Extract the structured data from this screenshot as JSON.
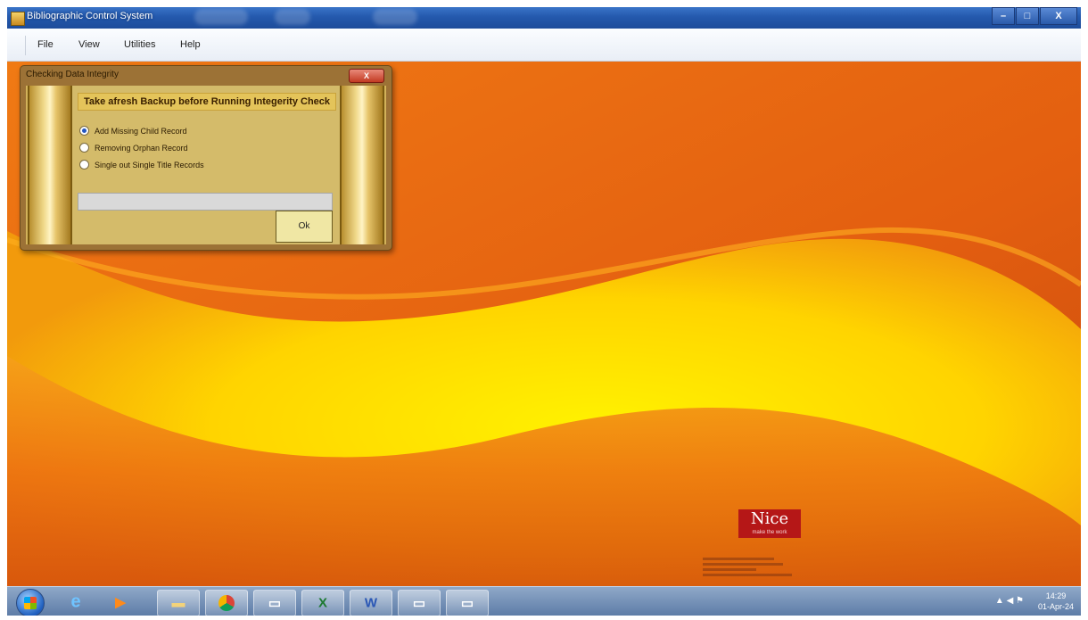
{
  "window": {
    "title": "Bibliographic Control System",
    "minimize_glyph": "–",
    "maximize_glyph": "□",
    "close_glyph": "X"
  },
  "menu": {
    "items": [
      "File",
      "View",
      "Utilities",
      "Help"
    ]
  },
  "dialog": {
    "title": "Checking Data Integrity",
    "close_glyph": "X",
    "warning": "Take afresh Backup before Running Integerity Check",
    "options": [
      {
        "label": "Add Missing Child Record",
        "selected": true
      },
      {
        "label": "Removing Orphan Record",
        "selected": false
      },
      {
        "label": "Single out Single Title Records",
        "selected": false
      }
    ],
    "progress_percent": 0,
    "ok_label": "Ok"
  },
  "desktop": {
    "logo_text": "Nice",
    "logo_sub": "make the work"
  },
  "taskbar": {
    "time": "14:29",
    "date": "01-Apr-24",
    "icons": [
      "start-orb-icon",
      "internet-explorer-icon",
      "media-player-icon",
      "file-explorer-icon",
      "chrome-icon",
      "window-icon",
      "excel-icon",
      "word-icon",
      "window-icon",
      "window-icon"
    ]
  },
  "colors": {
    "titlebar": "#2459ad",
    "desktop_orange": "#e86612",
    "desktop_yellow": "#ffe600",
    "dialog_gold": "#d2b25a",
    "logo_red": "#b51717"
  }
}
